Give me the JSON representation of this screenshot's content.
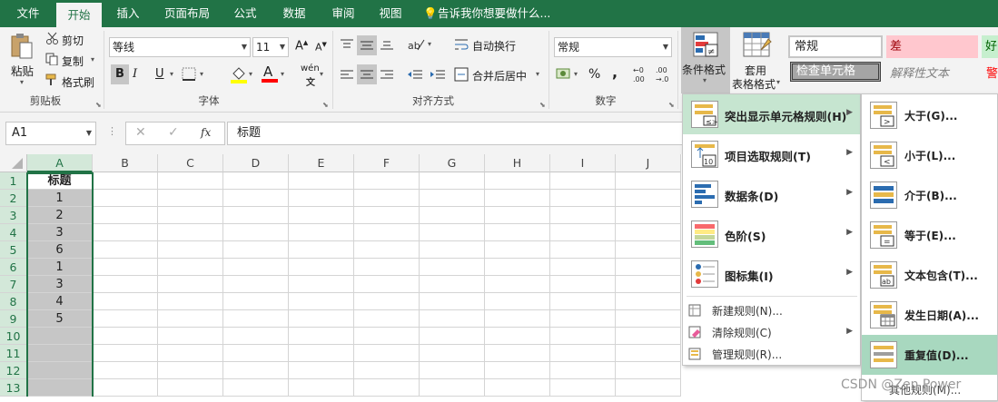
{
  "tabs": [
    "文件",
    "开始",
    "插入",
    "页面布局",
    "公式",
    "数据",
    "审阅",
    "视图"
  ],
  "tell_me": "告诉我你想要做什么...",
  "clipboard": {
    "paste": "粘贴",
    "cut": "剪切",
    "copy": "复制",
    "format_painter": "格式刷",
    "group": "剪贴板"
  },
  "font": {
    "name": "等线",
    "size": "11",
    "bold": "B",
    "italic": "I",
    "underline": "U",
    "phonetic": "wén",
    "group": "字体"
  },
  "alignment": {
    "wrap": "自动换行",
    "merge": "合并后居中",
    "group": "对齐方式"
  },
  "number": {
    "format": "常规",
    "percent": "%",
    "comma": ",",
    "group": "数字"
  },
  "styles": {
    "cond_format": "条件格式",
    "table_format_1": "套用",
    "table_format_2": "表格格式",
    "normal": "常规",
    "bad": "差",
    "good": "好",
    "check_cell": "检查单元格",
    "explanatory": "解释性文本",
    "warning": "警"
  },
  "formula_bar": {
    "name_box": "A1",
    "fx": "fx",
    "content": "标题"
  },
  "columns": [
    "A",
    "B",
    "C",
    "D",
    "E",
    "F",
    "G",
    "H",
    "I",
    "J"
  ],
  "rows": [
    "1",
    "2",
    "3",
    "4",
    "5",
    "6",
    "7",
    "8",
    "9",
    "10",
    "11",
    "12",
    "13"
  ],
  "column_a": [
    "标题",
    "1",
    "2",
    "3",
    "6",
    "1",
    "3",
    "4",
    "5",
    "",
    "",
    "",
    ""
  ],
  "cond_menu": {
    "highlight": "突出显示单元格规则(H)",
    "topbottom": "项目选取规则(T)",
    "databar": "数据条(D)",
    "colorscale": "色阶(S)",
    "iconset": "图标集(I)",
    "new_rule": "新建规则(N)...",
    "clear_rule": "清除规则(C)",
    "manage_rule": "管理规则(R)..."
  },
  "highlight_menu": {
    "greater": "大于(G)...",
    "less": "小于(L)...",
    "between": "介于(B)...",
    "equal": "等于(E)...",
    "text_contains": "文本包含(T)...",
    "date_occurring": "发生日期(A)...",
    "duplicate": "重复值(D)...",
    "more_rules": "其他规则(M)..."
  },
  "watermark": "CSDN @Zen Power",
  "colors": {
    "brand_green": "#217346",
    "selected_menu": "#c6e5d0",
    "duplicate_highlight": "#a8d8bf",
    "bad_fill": "#ffc7ce",
    "bad_text": "#9c0006",
    "good_fill": "#c6efce",
    "good_text": "#006100",
    "check_fill": "#a5a5a5",
    "warning_text": "#ff0000"
  }
}
